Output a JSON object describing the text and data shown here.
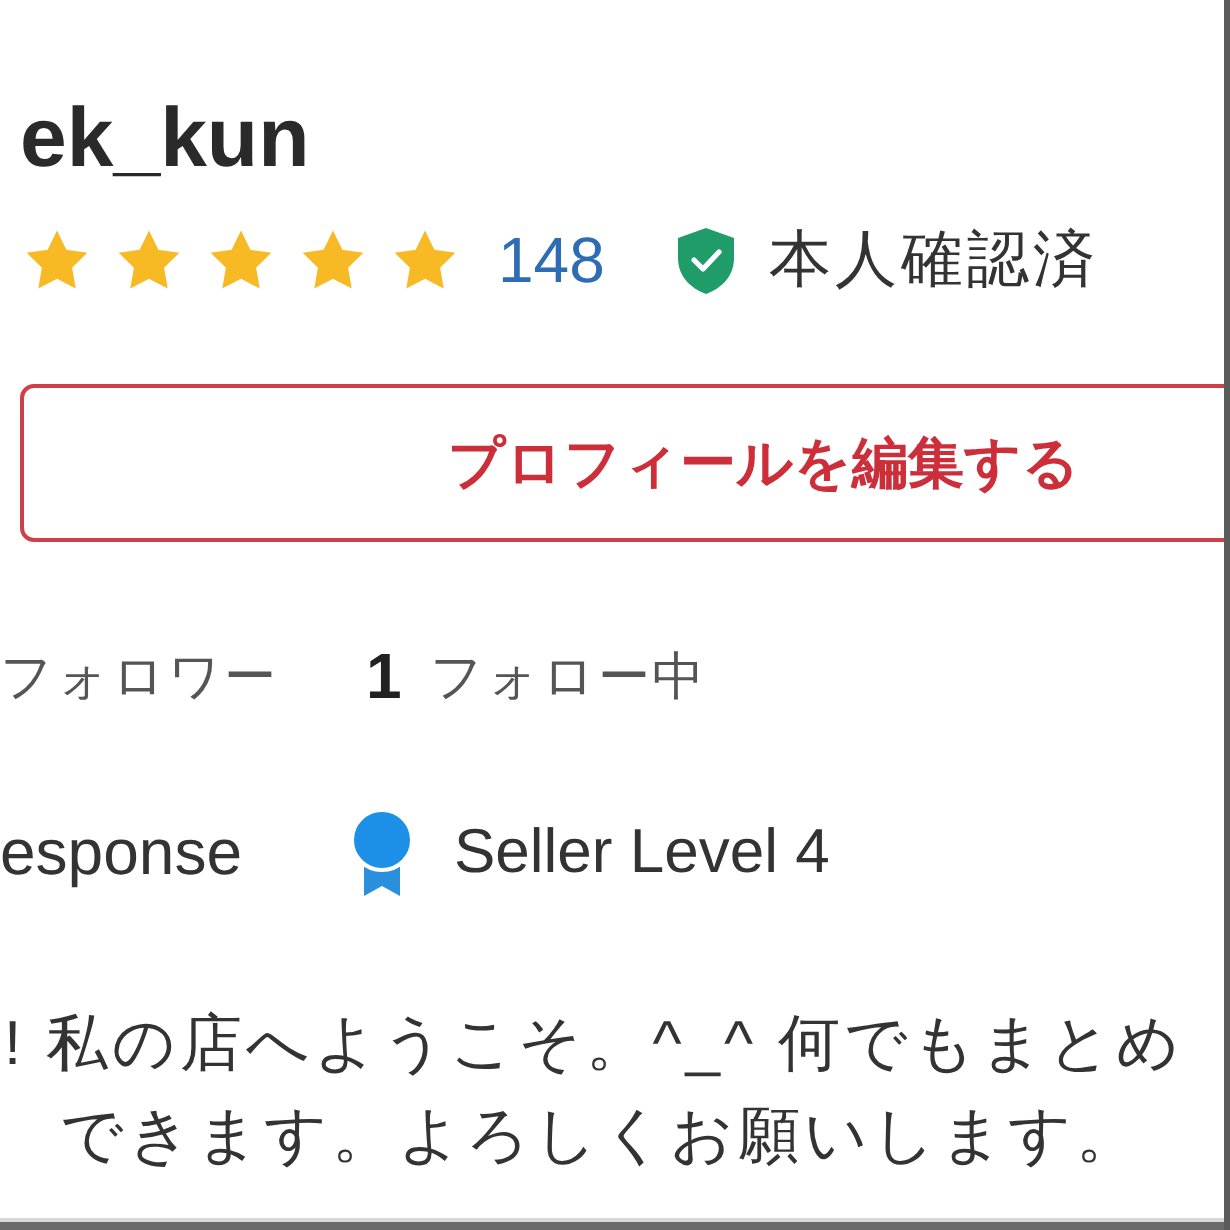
{
  "profile": {
    "username": "ek_kun",
    "rating": {
      "stars": 5,
      "count": "148"
    },
    "verification": {
      "verified": true,
      "label": "本人確認済"
    }
  },
  "edit_button": {
    "label": "プロフィールを編集する"
  },
  "follow_stats": {
    "followers": {
      "label": "フォロワー"
    },
    "following": {
      "count": "1",
      "label": "フォロー中"
    }
  },
  "response_rate": {
    "label": "esponse"
  },
  "seller_level": {
    "label": "Seller Level 4"
  },
  "description": [
    "! 私の店へようこそ。^_^ 何でもまとめ",
    "できます。よろしくお願いします。"
  ]
}
